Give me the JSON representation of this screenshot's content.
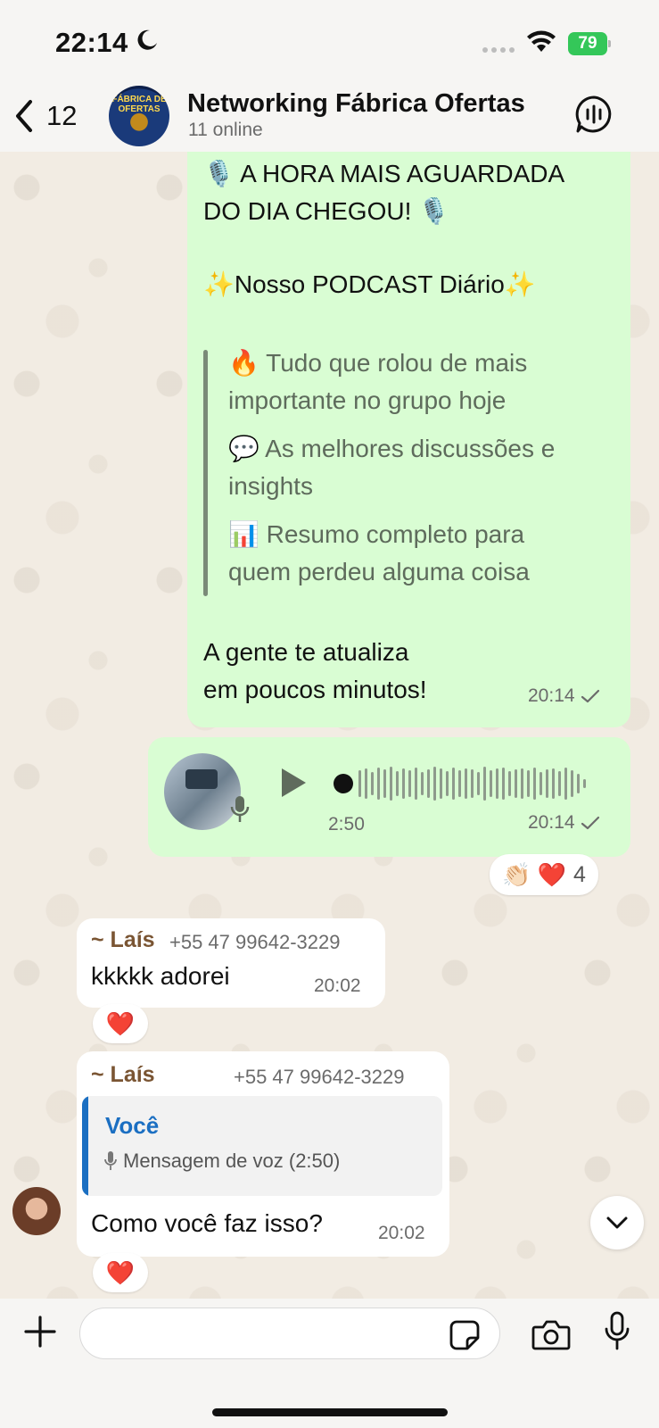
{
  "status_bar": {
    "time": "22:14",
    "battery": "79"
  },
  "header": {
    "back_count": "12",
    "group_name": "Networking Fábrica Ofertas",
    "subtitle": "11 online",
    "avatar_text": "FÁBRICA DE OFERTAS"
  },
  "messages": {
    "podcast": {
      "line1": "🎙️ A HORA MAIS AGUARDADA",
      "line2": "DO DIA CHEGOU! 🎙️",
      "line3": "✨Nosso PODCAST Diário✨",
      "quote": [
        {
          "l1": "🔥 Tudo que rolou de mais",
          "l2": "importante no grupo hoje"
        },
        {
          "l1": "💬 As melhores discussões e",
          "l2": "insights"
        },
        {
          "l1": "📊 Resumo completo para",
          "l2": "quem perdeu alguma coisa"
        }
      ],
      "footer1": "A gente te atualiza",
      "footer2": "em poucos minutos!",
      "time": "20:14"
    },
    "voice": {
      "duration": "2:50",
      "time": "20:14",
      "reactions": "👏🏻 ❤️",
      "reaction_count": "4"
    },
    "lais1": {
      "sender": "~ Laís",
      "phone": "+55 47 99642-3229",
      "text": "kkkkk adorei",
      "time": "20:02",
      "reaction": "❤️"
    },
    "lais2": {
      "sender": "~ Laís",
      "phone": "+55 47 99642-3229",
      "reply_author": "Você",
      "reply_text": "Mensagem de voz (2:50)",
      "text": "Como você faz isso?",
      "time": "20:02",
      "reaction": "❤️"
    }
  },
  "colors": {
    "outgoing_bubble": "#d9fdd3",
    "incoming_bubble": "#ffffff",
    "reply_accent": "#1b6fc2",
    "sender_name": "#7a5533",
    "battery": "#34c759"
  }
}
